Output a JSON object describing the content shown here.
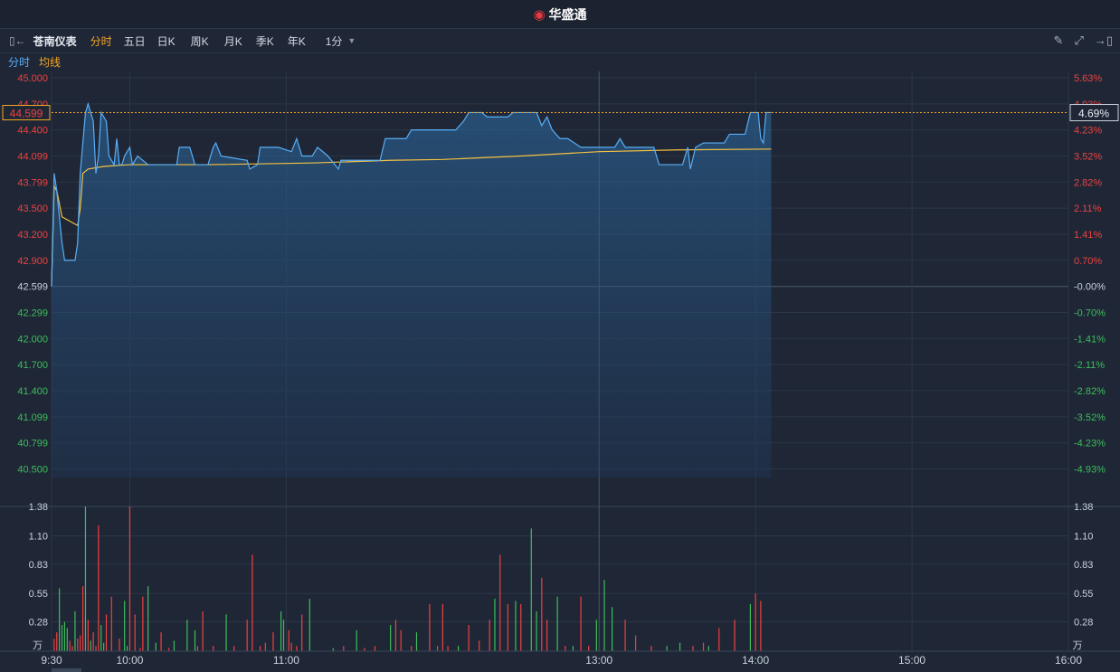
{
  "header": {
    "brand": "华盛通",
    "brand_icon": "weibo-logo-icon"
  },
  "toolbar": {
    "stock_name": "苍南仪表",
    "tabs": [
      "分时",
      "五日",
      "日K",
      "周K",
      "月K",
      "季K",
      "年K"
    ],
    "active_tab": "分时",
    "period": "1分",
    "icons": [
      "pencil-icon",
      "fullscreen-icon",
      "exit-icon"
    ]
  },
  "legend": {
    "line_label": "分时",
    "avg_label": "均线"
  },
  "colors": {
    "up": "#f0403e",
    "down": "#3dbd5a",
    "price_line": "#58aef7",
    "avg_line": "#f5c242",
    "current_price_marker": "#f5a623"
  },
  "chart_data": [
    {
      "type": "line",
      "title": "",
      "prev_close": 42.599,
      "current_price": "44.599",
      "current_change": "4.69%",
      "y_ticks": [
        "45.000",
        "44.700",
        "44.400",
        "44.099",
        "43.799",
        "43.500",
        "43.200",
        "42.900",
        "42.599",
        "42.299",
        "42.000",
        "41.700",
        "41.400",
        "41.099",
        "40.799",
        "40.500"
      ],
      "y_ticks_right": [
        "5.63%",
        "4.93%",
        "4.23%",
        "3.52%",
        "2.82%",
        "2.11%",
        "1.41%",
        "0.70%",
        "-0.00%",
        "-0.70%",
        "-1.41%",
        "-2.11%",
        "-2.82%",
        "-3.52%",
        "-4.23%",
        "-4.93%"
      ],
      "ylim": [
        40.4,
        45.0
      ],
      "x_ticks": [
        "9:30",
        "10:00",
        "11:00",
        "13:00",
        "14:00",
        "15:00",
        "16:00"
      ],
      "x_tick_minutes": [
        0,
        30,
        90,
        210,
        270,
        330,
        390
      ],
      "xlim_minutes": [
        0,
        390
      ],
      "grid": true,
      "series": [
        {
          "name": "分时",
          "points": [
            [
              0,
              42.6
            ],
            [
              1,
              43.9
            ],
            [
              2,
              43.7
            ],
            [
              4,
              43.1
            ],
            [
              5,
              42.9
            ],
            [
              9,
              42.9
            ],
            [
              10,
              43.1
            ],
            [
              11,
              43.9
            ],
            [
              13,
              44.6
            ],
            [
              14,
              44.7
            ],
            [
              16,
              44.5
            ],
            [
              17,
              43.9
            ],
            [
              18,
              44.1
            ],
            [
              19,
              44.6
            ],
            [
              21,
              44.5
            ],
            [
              22,
              44.1
            ],
            [
              24,
              44.0
            ],
            [
              25,
              44.3
            ],
            [
              26,
              44.0
            ],
            [
              27,
              44.0
            ],
            [
              28,
              44.1
            ],
            [
              30,
              44.2
            ],
            [
              31,
              44.0
            ],
            [
              33,
              44.1
            ],
            [
              35,
              44.05
            ],
            [
              37,
              44.0
            ],
            [
              41,
              44.0
            ],
            [
              48,
              44.0
            ],
            [
              49,
              44.2
            ],
            [
              53,
              44.2
            ],
            [
              55,
              44.0
            ],
            [
              60,
              44.0
            ],
            [
              62,
              44.2
            ],
            [
              63,
              44.25
            ],
            [
              65,
              44.1
            ],
            [
              75,
              44.05
            ],
            [
              76,
              43.95
            ],
            [
              79,
              44.0
            ],
            [
              80,
              44.2
            ],
            [
              87,
              44.2
            ],
            [
              92,
              44.15
            ],
            [
              94,
              44.3
            ],
            [
              96,
              44.1
            ],
            [
              100,
              44.1
            ],
            [
              102,
              44.2
            ],
            [
              106,
              44.1
            ],
            [
              110,
              43.95
            ],
            [
              111,
              44.05
            ],
            [
              126,
              44.05
            ],
            [
              128,
              44.3
            ],
            [
              136,
              44.3
            ],
            [
              138,
              44.4
            ],
            [
              155,
              44.4
            ],
            [
              158,
              44.5
            ],
            [
              160,
              44.6
            ],
            [
              165,
              44.6
            ],
            [
              167,
              44.55
            ],
            [
              175,
              44.55
            ],
            [
              177,
              44.6
            ],
            [
              186,
              44.6
            ],
            [
              188,
              44.45
            ],
            [
              190,
              44.55
            ],
            [
              192,
              44.4
            ],
            [
              195,
              44.3
            ],
            [
              198,
              44.3
            ],
            [
              203,
              44.2
            ],
            [
              216,
              44.2
            ],
            [
              218,
              44.3
            ],
            [
              220,
              44.2
            ],
            [
              231,
              44.2
            ],
            [
              233,
              44.0
            ],
            [
              242,
              44.0
            ],
            [
              244,
              44.2
            ],
            [
              245,
              43.95
            ],
            [
              247,
              44.2
            ],
            [
              250,
              44.25
            ],
            [
              258,
              44.25
            ],
            [
              260,
              44.35
            ],
            [
              266,
              44.35
            ],
            [
              268,
              44.6
            ],
            [
              271,
              44.6
            ],
            [
              272,
              44.3
            ],
            [
              273,
              44.25
            ],
            [
              274,
              44.6
            ],
            [
              276,
              44.6
            ]
          ]
        },
        {
          "name": "均线",
          "points": [
            [
              0,
              42.6
            ],
            [
              1,
              43.75
            ],
            [
              2,
              43.7
            ],
            [
              4,
              43.4
            ],
            [
              10,
              43.3
            ],
            [
              11,
              43.5
            ],
            [
              12,
              43.9
            ],
            [
              14,
              43.95
            ],
            [
              20,
              43.98
            ],
            [
              30,
              44.0
            ],
            [
              60,
              44.0
            ],
            [
              100,
              44.02
            ],
            [
              130,
              44.05
            ],
            [
              150,
              44.06
            ],
            [
              180,
              44.1
            ],
            [
              210,
              44.15
            ],
            [
              240,
              44.17
            ],
            [
              276,
              44.18
            ]
          ]
        }
      ]
    },
    {
      "type": "bar",
      "title": "",
      "unit": "万",
      "y_ticks": [
        "1.38",
        "1.10",
        "0.83",
        "0.55",
        "0.28"
      ],
      "ylim": [
        0,
        1.38
      ],
      "x_minutes": [
        1,
        2,
        3,
        4,
        5,
        6,
        7,
        8,
        9,
        10,
        11,
        12,
        13,
        14,
        15,
        16,
        17,
        18,
        19,
        20,
        21,
        23,
        26,
        28,
        29,
        30,
        32,
        34,
        35,
        37,
        40,
        42,
        45,
        47,
        52,
        55,
        56,
        58,
        62,
        67,
        70,
        75,
        77,
        80,
        82,
        85,
        88,
        89,
        91,
        92,
        94,
        96,
        99,
        108,
        112,
        117,
        120,
        124,
        130,
        132,
        134,
        138,
        140,
        145,
        148,
        150,
        152,
        156,
        160,
        164,
        168,
        170,
        172,
        175,
        178,
        180,
        184,
        186,
        188,
        190,
        194,
        197,
        200,
        203,
        206,
        209,
        212,
        215,
        220,
        224,
        230,
        236,
        241,
        246,
        250,
        252,
        256,
        262,
        268,
        270,
        272
      ],
      "values": [
        0.12,
        0.18,
        0.6,
        0.25,
        0.28,
        0.22,
        0.1,
        0.05,
        0.38,
        0.12,
        0.15,
        0.62,
        1.38,
        0.3,
        0.1,
        0.18,
        0.05,
        1.2,
        0.25,
        0.08,
        0.35,
        0.52,
        0.12,
        0.48,
        0.05,
        1.38,
        0.35,
        0.03,
        0.52,
        0.62,
        0.08,
        0.18,
        0.03,
        0.1,
        0.3,
        0.2,
        0.05,
        0.38,
        0.05,
        0.35,
        0.05,
        0.3,
        0.92,
        0.05,
        0.08,
        0.18,
        0.38,
        0.3,
        0.2,
        0.08,
        0.05,
        0.35,
        0.5,
        0.03,
        0.05,
        0.2,
        0.03,
        0.05,
        0.25,
        0.3,
        0.2,
        0.05,
        0.18,
        0.45,
        0.05,
        0.45,
        0.05,
        0.05,
        0.25,
        0.1,
        0.3,
        0.5,
        0.92,
        0.45,
        0.48,
        0.45,
        1.17,
        0.38,
        0.7,
        0.3,
        0.52,
        0.05,
        0.05,
        0.52,
        0.05,
        0.3,
        0.68,
        0.42,
        0.3,
        0.15,
        0.05,
        0.05,
        0.08,
        0.05,
        0.08,
        0.05,
        0.22,
        0.3,
        0.45,
        0.55,
        0.48
      ],
      "colors": [
        "up",
        "up",
        "down",
        "down",
        "down",
        "down",
        "up",
        "up",
        "down",
        "up",
        "up",
        "up",
        "down",
        "up",
        "down",
        "up",
        "up",
        "up",
        "down",
        "down",
        "up",
        "up",
        "up",
        "down",
        "down",
        "up",
        "up",
        "up",
        "up",
        "down",
        "down",
        "up",
        "up",
        "down",
        "down",
        "down",
        "up",
        "up",
        "up",
        "down",
        "up",
        "up",
        "up",
        "up",
        "up",
        "up",
        "down",
        "down",
        "up",
        "up",
        "up",
        "up",
        "down",
        "down",
        "up",
        "down",
        "up",
        "up",
        "down",
        "up",
        "up",
        "up",
        "down",
        "up",
        "up",
        "up",
        "up",
        "down",
        "up",
        "up",
        "up",
        "down",
        "up",
        "up",
        "down",
        "up",
        "down",
        "down",
        "up",
        "up",
        "down",
        "up",
        "down",
        "up",
        "up",
        "down",
        "down",
        "down",
        "up",
        "up",
        "up",
        "down",
        "down",
        "up",
        "up",
        "down",
        "up",
        "up",
        "down",
        "up",
        "up"
      ]
    }
  ]
}
